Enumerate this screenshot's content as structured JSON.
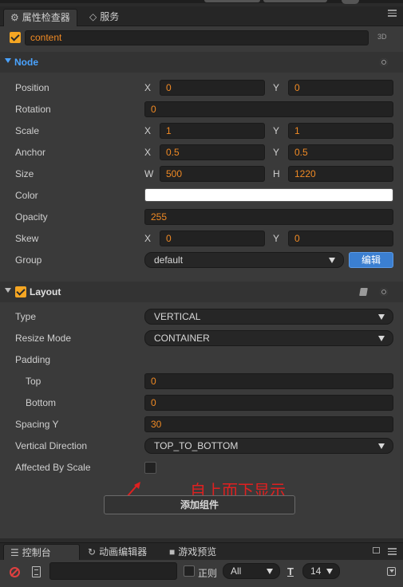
{
  "tabs": {
    "inspector": "属性检查器",
    "services": "服务"
  },
  "node": {
    "name": "content",
    "mode_3d": "3D"
  },
  "node_section": {
    "title": "Node",
    "position": {
      "label": "Position",
      "x": "0",
      "y": "0"
    },
    "rotation": {
      "label": "Rotation",
      "value": "0"
    },
    "scale": {
      "label": "Scale",
      "x": "1",
      "y": "1"
    },
    "anchor": {
      "label": "Anchor",
      "x": "0.5",
      "y": "0.5"
    },
    "size": {
      "label": "Size",
      "w": "500",
      "h": "1220"
    },
    "color": {
      "label": "Color",
      "value": "#ffffff"
    },
    "opacity": {
      "label": "Opacity",
      "value": "255"
    },
    "skew": {
      "label": "Skew",
      "x": "0",
      "y": "0"
    },
    "group": {
      "label": "Group",
      "value": "default",
      "edit_label": "编辑"
    },
    "axis_x": "X",
    "axis_y": "Y",
    "axis_w": "W",
    "axis_h": "H"
  },
  "layout_section": {
    "title": "Layout",
    "type": {
      "label": "Type",
      "value": "VERTICAL"
    },
    "resize_mode": {
      "label": "Resize Mode",
      "value": "CONTAINER"
    },
    "padding": {
      "label": "Padding"
    },
    "top": {
      "label": "Top",
      "value": "0"
    },
    "bottom": {
      "label": "Bottom",
      "value": "0"
    },
    "spacing_y": {
      "label": "Spacing Y",
      "value": "30"
    },
    "vertical_direction": {
      "label": "Vertical Direction",
      "value": "TOP_TO_BOTTOM"
    },
    "affected_by_scale": {
      "label": "Affected By Scale",
      "checked": false
    }
  },
  "annotation": "自上而下显示",
  "add_component_label": "添加组件",
  "bottom_tabs": {
    "console": "控制台",
    "animation": "动画编辑器",
    "preview": "游戏预览"
  },
  "console_toolbar": {
    "search_value": "",
    "regex_label": "正则",
    "level_value": "All",
    "font_size_value": "14"
  },
  "colors": {
    "accent_orange": "#f08a24",
    "accent_blue": "#4aa3ff",
    "annotation_red": "#e02020",
    "edit_button_blue": "#3b7fd1"
  }
}
